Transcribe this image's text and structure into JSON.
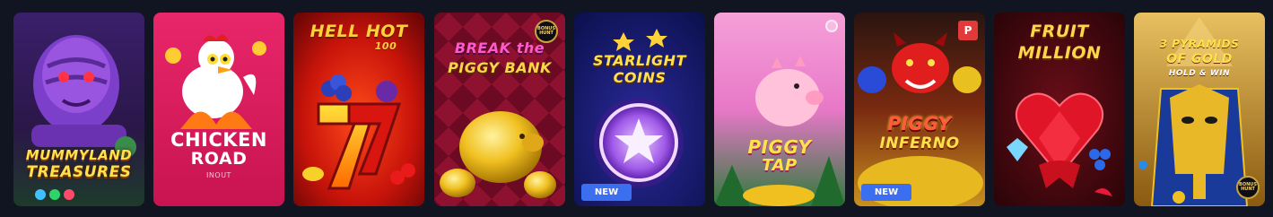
{
  "games": [
    {
      "title": "MUMMYLAND TREASURES",
      "title_line1": "MUMMYLAND",
      "title_line2": "TREASURES"
    },
    {
      "title": "CHICKEN ROAD",
      "title_line1": "CHICKEN",
      "title_line2": "ROAD",
      "provider": "INOUT"
    },
    {
      "title": "HELL HOT 100",
      "title_line1": "HELL HOT",
      "title_line2": "100"
    },
    {
      "title": "BREAK the PIGGY BANK",
      "title_line1": "BREAK the",
      "title_line2": "PIGGY BANK",
      "corner_badge": "BONUS HUNT"
    },
    {
      "title": "STARLIGHT COINS",
      "title_line1": "STARLIGHT",
      "title_line2": "COINS",
      "badge": "NEW"
    },
    {
      "title": "PIGGY TAP",
      "title_line1": "PIGGY",
      "title_line2": "TAP"
    },
    {
      "title": "PIGGY INFERNO",
      "title_line1": "PIGGY",
      "title_line2": "INFERNO",
      "badge": "NEW",
      "corner_badge": "P"
    },
    {
      "title": "FRUIT MILLION",
      "title_line1": "FRUIT",
      "title_line2": "MILLION"
    },
    {
      "title": "3 PYRAMIDS OF GOLD HOLD & WIN",
      "title_line1": "3 PYRAMIDS",
      "title_line2": "OF GOLD",
      "title_line3": "HOLD & WIN",
      "corner_badge": "BONUS HUNT"
    }
  ],
  "colors": {
    "background": "#101521",
    "new_badge": "#3b6ff0"
  }
}
